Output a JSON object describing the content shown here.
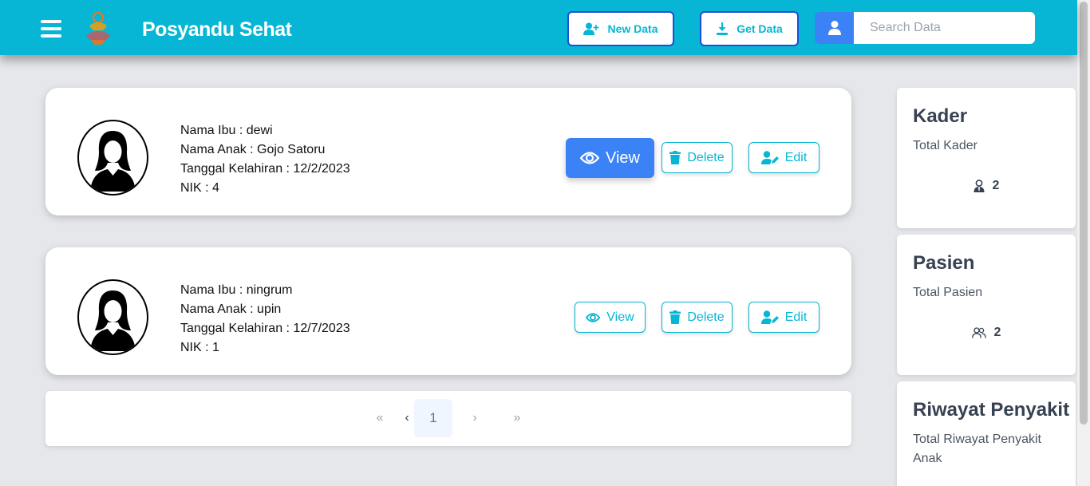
{
  "header": {
    "brand": "Posyandu Sehat",
    "menu_icon": "hamburger-icon",
    "logo_icon": "posyandu-logo",
    "new_data_label": "New Data",
    "get_data_label": "Get Data",
    "search_placeholder": "Search Data",
    "colors": {
      "navbar": "#06b6d4",
      "accent": "#3b82f6",
      "button_border": "#1d4ed8"
    }
  },
  "records": [
    {
      "nama_ibu": "Nama Ibu : dewi",
      "nama_anak": "Nama Anak : Gojo Satoru",
      "tanggal_kelahiran": "Tanggal Kelahiran : 12/2/2023",
      "nik": "NIK : 4",
      "view_label": "View",
      "delete_label": "Delete",
      "edit_label": "Edit"
    },
    {
      "nama_ibu": "Nama Ibu : ningrum",
      "nama_anak": "Nama Anak : upin",
      "tanggal_kelahiran": "Tanggal Kelahiran : 12/7/2023",
      "nik": "NIK : 1",
      "view_label": "View",
      "delete_label": "Delete",
      "edit_label": "Edit"
    }
  ],
  "pagination": {
    "first": "«",
    "prev": "‹",
    "current": "1",
    "next": "›",
    "last": "»"
  },
  "stats": [
    {
      "title": "Kader",
      "subtitle": "Total Kader",
      "count": "2",
      "icon": "user-tie-icon"
    },
    {
      "title": "Pasien",
      "subtitle": "Total Pasien",
      "count": "2",
      "icon": "users-icon"
    },
    {
      "title": "Riwayat Penyakit",
      "subtitle": "Total Riwayat Penyakit Anak",
      "count": "",
      "icon": ""
    }
  ]
}
